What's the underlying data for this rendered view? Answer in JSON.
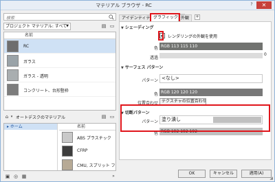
{
  "window": {
    "title": "マテリアル ブラウザ - RC",
    "help": "?",
    "close": "✕"
  },
  "left": {
    "search_placeholder": "検索",
    "project_dropdown": "プロジェクト マテリアル: すべて",
    "list_header": "名前",
    "materials": [
      {
        "name": "RC",
        "thumb": "#6e6e6e"
      },
      {
        "name": "ガラス",
        "thumb": "#9aa3a8"
      },
      {
        "name": "ガラス - 透明",
        "thumb": "#a9aeb0"
      },
      {
        "name": "コンクリート、台形竪枠",
        "thumb": "#7c7c7c"
      }
    ],
    "library_label": "オートデスクのマテリアル",
    "tree_item": "ホーム",
    "lib_header": "名前",
    "library": [
      {
        "name": "ABS プラスチック",
        "thumb": "#c9c9c9"
      },
      {
        "name": "CFRP",
        "thumb": "#3d3d3d"
      },
      {
        "name": "CMU, スプリット フェース",
        "thumb": "#b7aa96"
      }
    ]
  },
  "right": {
    "tabs": [
      "アイデンティティ",
      "グラフィックス",
      "外観"
    ],
    "shading": {
      "title": "シェーディング",
      "checkbox_label": "レンダリングの外観を使用",
      "color_label": "色",
      "color_value": "RGB 113 115 110",
      "color_hex": "#717370",
      "transparency_label": "透過",
      "transparency_value": "0"
    },
    "surface_pattern": {
      "title": "サーフェス パターン",
      "pattern_label": "パターン",
      "pattern_value": "<なし>",
      "color_label": "色",
      "color_value": "RGB 120 120 120",
      "color_hex": "#787878",
      "align_label": "位置合わせ",
      "align_button": "テクスチャの位置合わせ..."
    },
    "cut_pattern": {
      "title": "切断パターン",
      "pattern_label": "パターン",
      "pattern_value": "塗り潰し",
      "color_label": "色",
      "color_value": "RGB 192 192 192",
      "color_hex": "#c0c0c0"
    }
  },
  "footer": {
    "ok": "OK",
    "cancel": "キャンセル",
    "apply": "適用(A)"
  },
  "colors": {
    "highlight": "#e0141a",
    "selection": "#cfe1f5"
  }
}
